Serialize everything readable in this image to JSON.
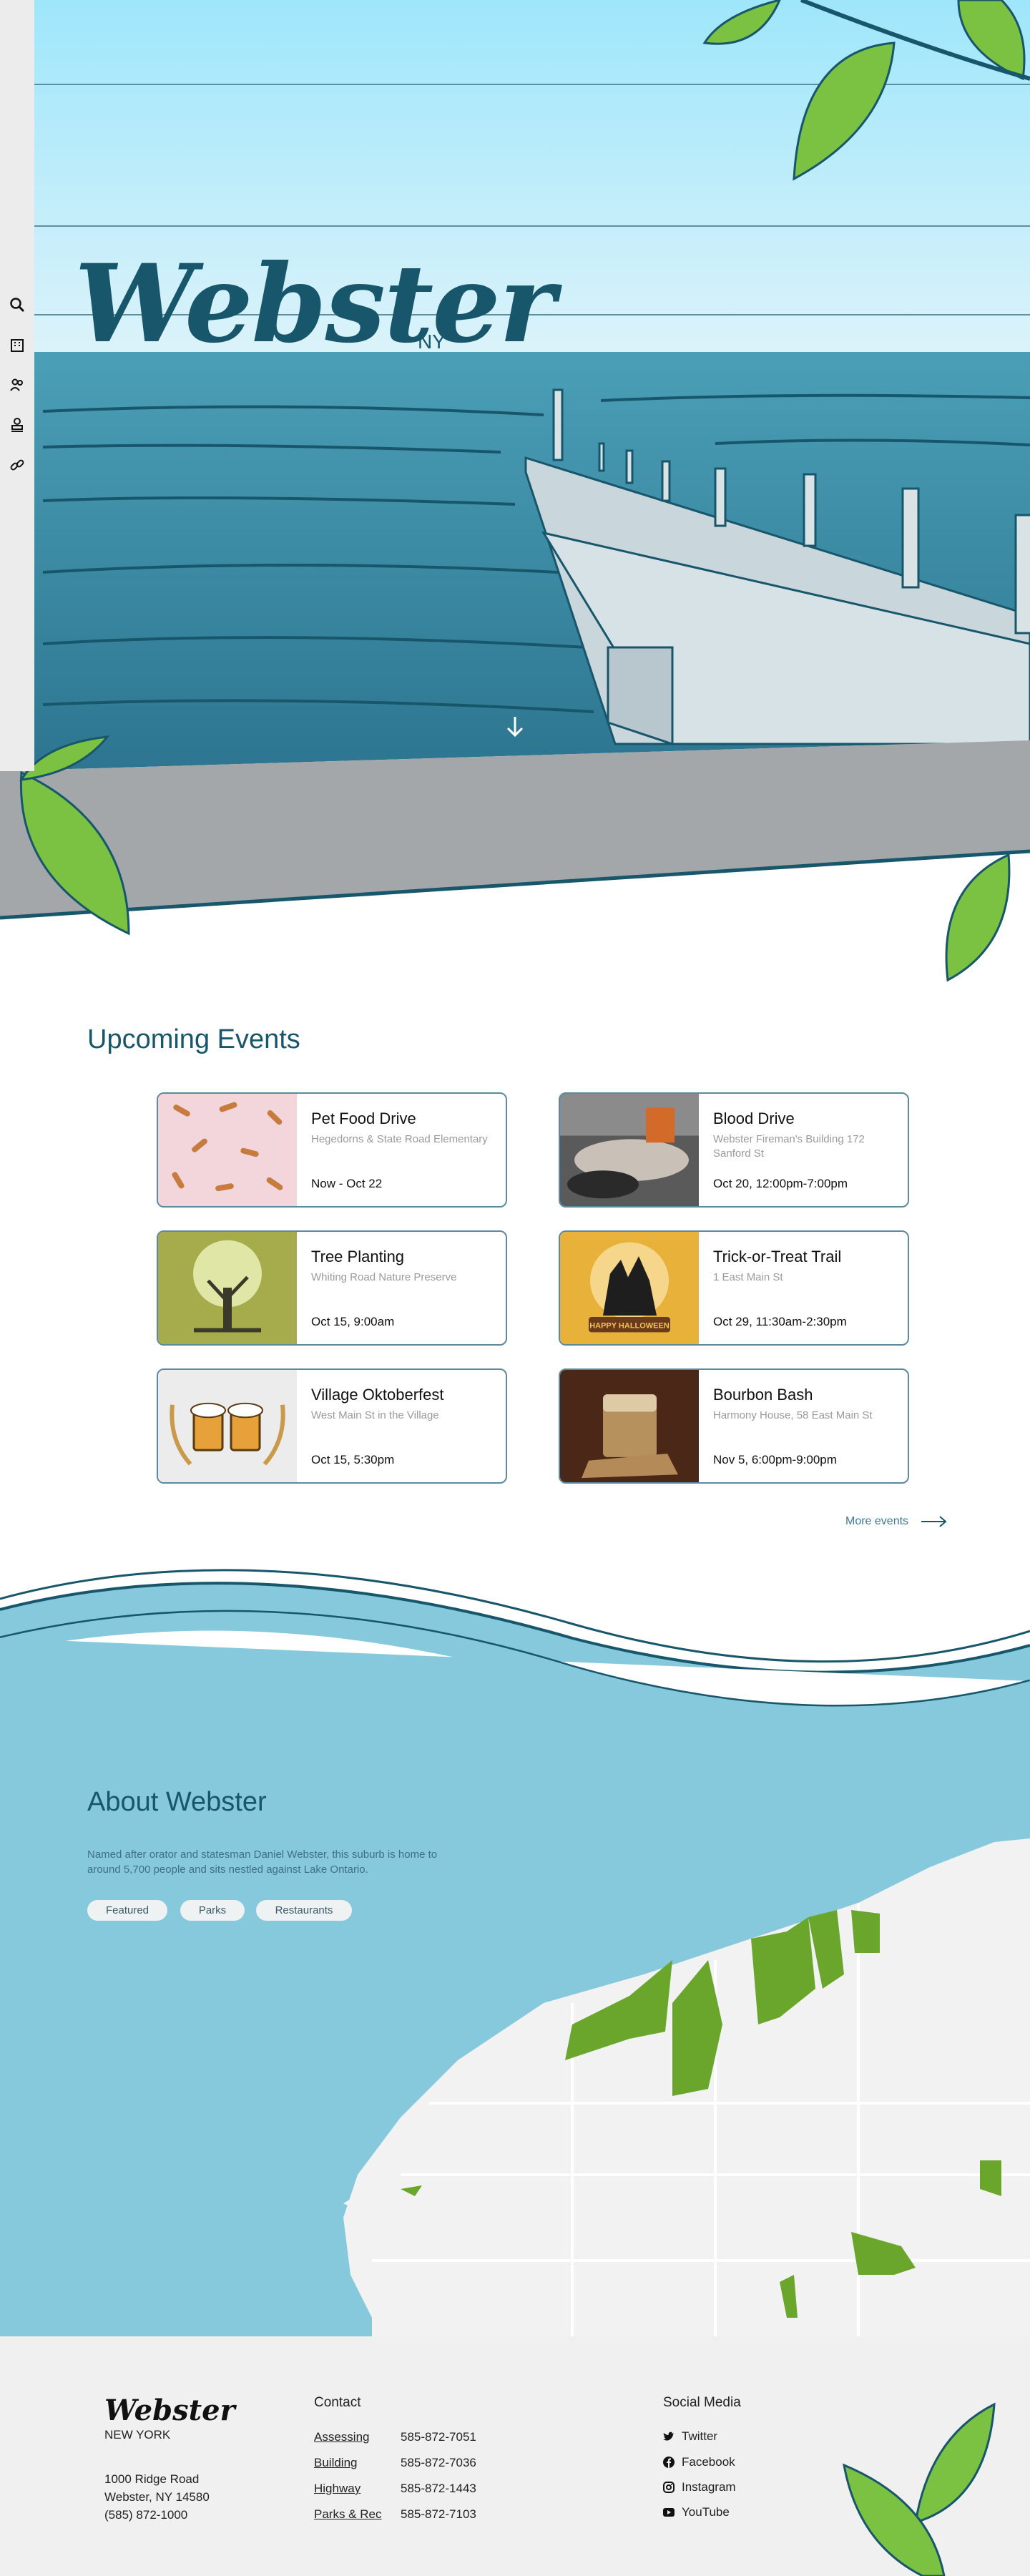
{
  "sidebar": {
    "icons": [
      "search-icon",
      "building-icon",
      "people-icon",
      "stamp-icon",
      "link-icon"
    ]
  },
  "hero": {
    "title": "Webster",
    "suffix": "NY"
  },
  "events": {
    "heading": "Upcoming Events",
    "items": [
      {
        "name": "Pet Food Drive",
        "location": "Hegedorns & State Road Elementary",
        "date": "Now - Oct 22",
        "image": "dog-bones-image"
      },
      {
        "name": "Blood Drive",
        "location": "Webster Fireman's Building 172 Sanford St",
        "date": "Oct 20, 12:00pm-7:00pm",
        "image": "blood-donation-image"
      },
      {
        "name": "Tree Planting",
        "location": "Whiting Road Nature Preserve",
        "date": "Oct 15, 9:00am",
        "image": "tree-image"
      },
      {
        "name": "Trick-or-Treat Trail",
        "location": "1 East Main St",
        "date": "Oct 29, 11:30am-2:30pm",
        "image": "halloween-image",
        "image_text": "HAPPY HALLOWEEN"
      },
      {
        "name": "Village Oktoberfest",
        "location": "West Main St in the Village",
        "date": "Oct 15, 5:30pm",
        "image": "beer-mugs-image"
      },
      {
        "name": "Bourbon Bash",
        "location": "Harmony House, 58 East Main St",
        "date": "Nov 5, 6:00pm-9:00pm",
        "image": "bourbon-glass-image"
      }
    ],
    "more_label": "More events"
  },
  "about": {
    "heading": "About Webster",
    "text": "Named after orator and statesman Daniel Webster, this suburb is home to around 5,700 people and sits nestled against Lake Ontario.",
    "filters": [
      "Featured",
      "Parks",
      "Restaurants"
    ]
  },
  "footer": {
    "logo": "Webster",
    "state": "NEW YORK",
    "address_line1": "1000 Ridge Road",
    "address_line2": "Webster, NY 14580",
    "phone": "(585) 872-1000",
    "contact_heading": "Contact",
    "contacts": [
      {
        "label": "Assessing",
        "phone": "585-872-7051"
      },
      {
        "label": "Building",
        "phone": "585-872-7036"
      },
      {
        "label": "Highway",
        "phone": "585-872-1443"
      },
      {
        "label": "Parks & Rec",
        "phone": "585-872-7103"
      }
    ],
    "social_heading": "Social Media",
    "socials": [
      {
        "label": "Twitter",
        "icon": "twitter-icon"
      },
      {
        "label": "Facebook",
        "icon": "facebook-icon"
      },
      {
        "label": "Instagram",
        "icon": "instagram-icon"
      },
      {
        "label": "YouTube",
        "icon": "youtube-icon"
      }
    ]
  },
  "colors": {
    "brand": "#17566b",
    "sky": "#a8e4f5",
    "water": "#3f8fa6",
    "about_bg": "#86c9dc",
    "leaf": "#7cc242",
    "map_green": "#6aa52c"
  }
}
